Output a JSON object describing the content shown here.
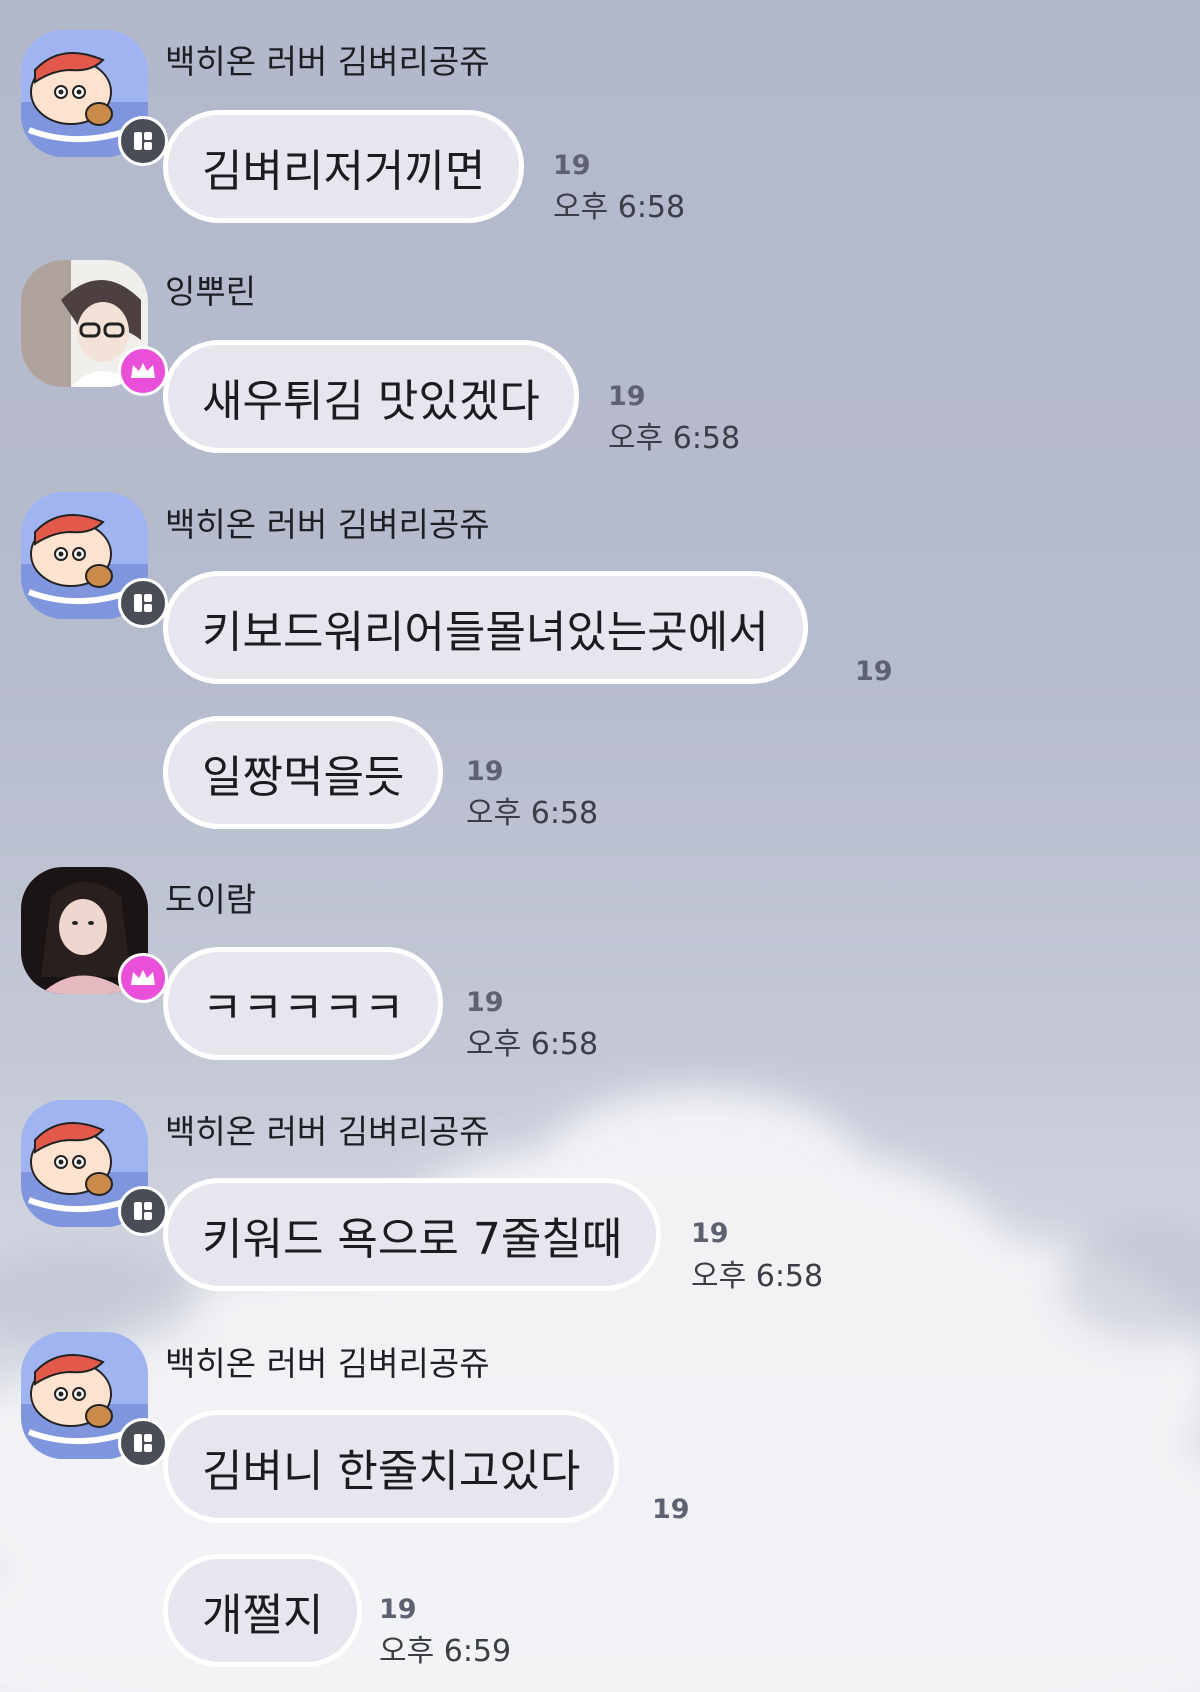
{
  "messages": [
    {
      "sender": "백히온 러버 김벼리공쥬",
      "avatar": "shinchan-avatar",
      "badge": "manager-badge-icon",
      "bubbles": [
        {
          "text": "김벼리저거끼면",
          "unread": "19",
          "time": "오후 6:58"
        }
      ]
    },
    {
      "sender": "잉뿌린",
      "avatar": "photo-avatar",
      "badge": "crown-badge-icon",
      "bubbles": [
        {
          "text": "새우튀김 맛있겠다",
          "unread": "19",
          "time": "오후 6:58"
        }
      ]
    },
    {
      "sender": "백히온 러버 김벼리공쥬",
      "avatar": "shinchan-avatar",
      "badge": "manager-badge-icon",
      "bubbles": [
        {
          "text": "키보드워리어들몰녀있는곳에서",
          "unread": "19",
          "time": ""
        },
        {
          "text": "일짱먹을듯",
          "unread": "19",
          "time": "오후 6:58"
        }
      ]
    },
    {
      "sender": "도이람",
      "avatar": "photo-avatar",
      "badge": "crown-badge-icon",
      "bubbles": [
        {
          "text": "ㅋㅋㅋㅋㅋ",
          "unread": "19",
          "time": "오후 6:58"
        }
      ]
    },
    {
      "sender": "백히온 러버 김벼리공쥬",
      "avatar": "shinchan-avatar",
      "badge": "manager-badge-icon",
      "bubbles": [
        {
          "text": "키워드 욕으로 7줄칠때",
          "unread": "19",
          "time": "오후 6:58"
        }
      ]
    },
    {
      "sender": "백히온 러버 김벼리공쥬",
      "avatar": "shinchan-avatar",
      "badge": "manager-badge-icon",
      "bubbles": [
        {
          "text": "김벼니 한줄치고있다",
          "unread": "19",
          "time": ""
        },
        {
          "text": "개쩔지",
          "unread": "19",
          "time": "오후 6:59"
        }
      ]
    }
  ],
  "colors": {
    "bubble_fill": "#e6e6ee",
    "bubble_border": "#ffffff",
    "crown_badge": "#e94fd8",
    "manager_badge": "#4a4d56"
  }
}
